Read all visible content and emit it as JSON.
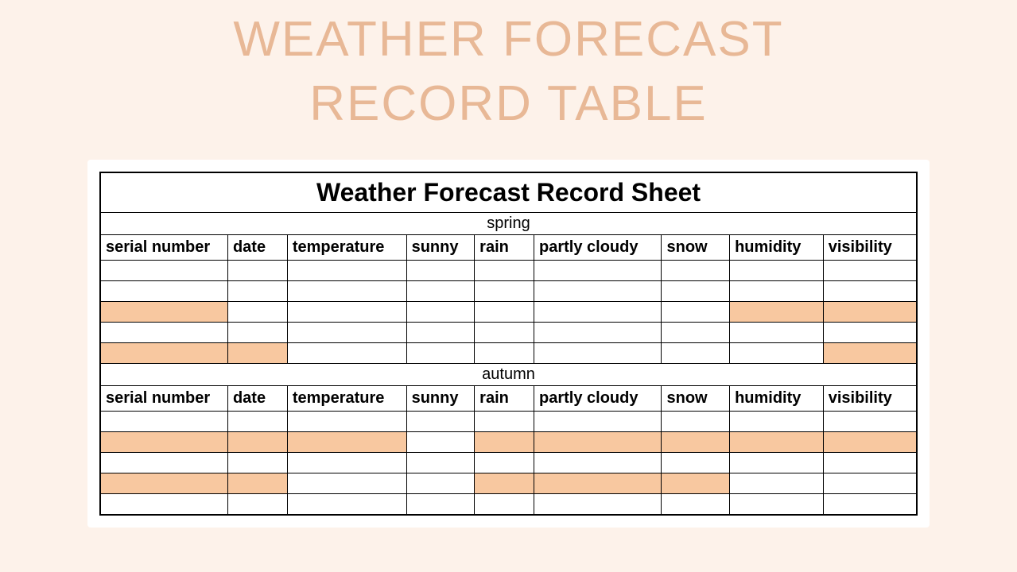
{
  "page_title_line1": "WEATHER FORECAST",
  "page_title_line2": "RECORD TABLE",
  "sheet_title": "Weather Forecast Record Sheet",
  "columns": {
    "serial": "serial number",
    "date": "date",
    "temperature": "temperature",
    "sunny": "sunny",
    "rain": "rain",
    "partly_cloudy": "partly cloudy",
    "snow": "snow",
    "humidity": "humidity",
    "visibility": "visibility"
  },
  "sections": {
    "spring": "spring",
    "autumn": "autumn"
  }
}
